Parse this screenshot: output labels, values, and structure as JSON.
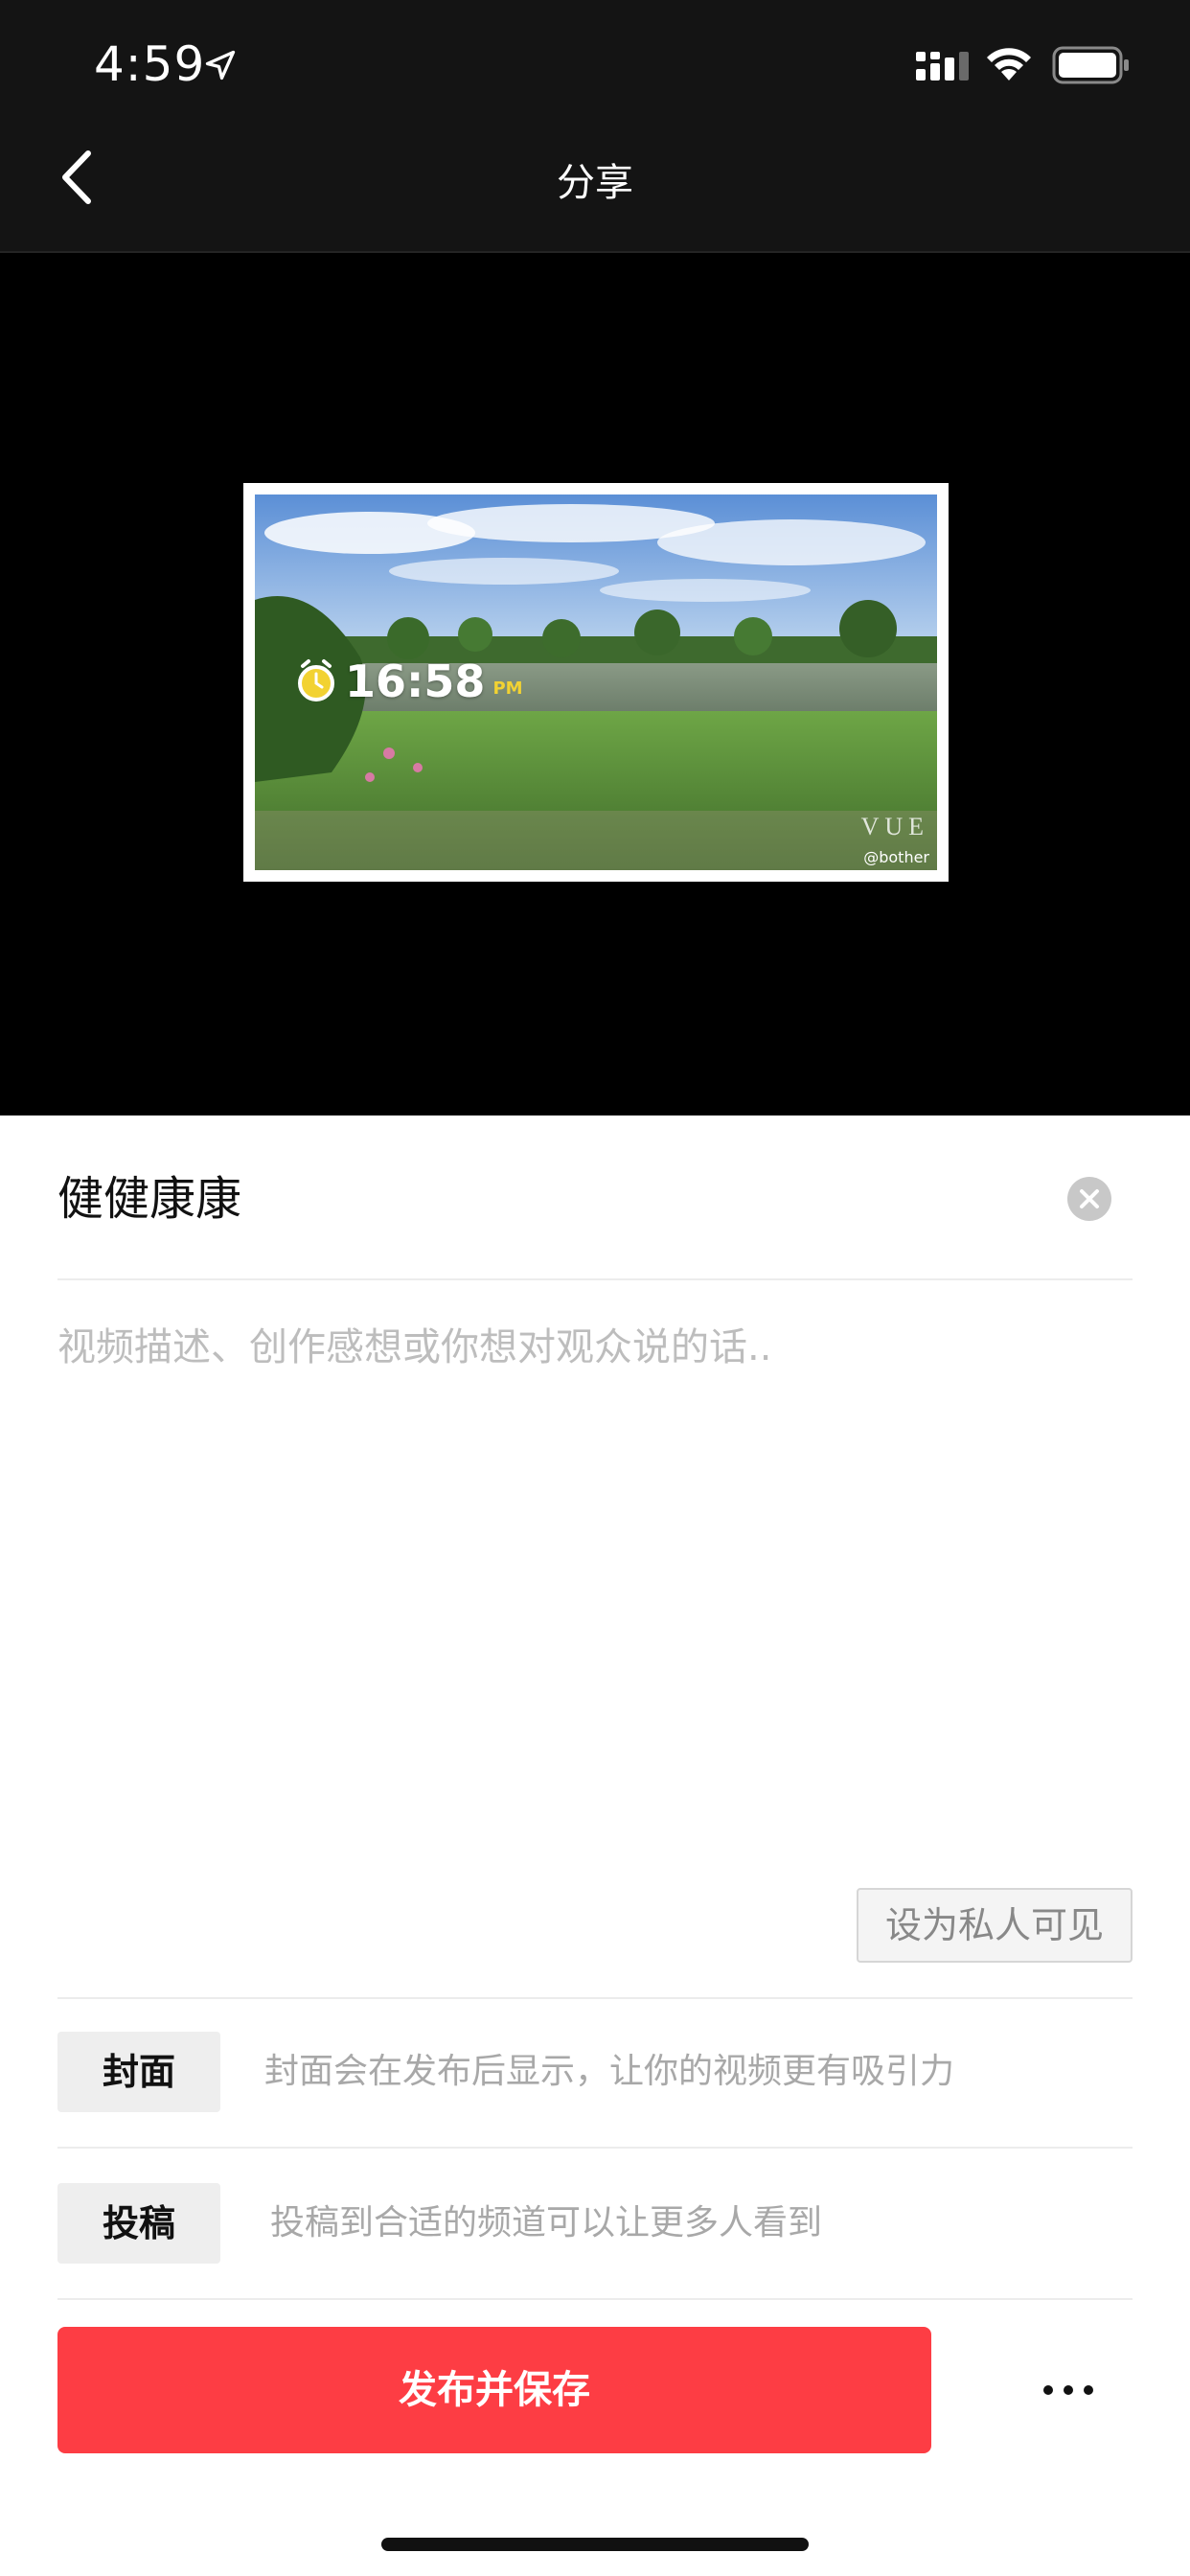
{
  "status_bar": {
    "time": "4:59"
  },
  "nav": {
    "title": "分享",
    "back_icon": "chevron-left-icon"
  },
  "preview": {
    "clock_time": "16:58",
    "clock_ampm": "PM",
    "brand": "VUE",
    "watermark": "@bother"
  },
  "form": {
    "title_value": "健健康康",
    "description_placeholder": "视频描述、创作感想或你想对观众说的话..",
    "private_button": "设为私人可见",
    "cover": {
      "label": "封面",
      "hint": "封面会在发布后显示，让你的视频更有吸引力"
    },
    "submit": {
      "label": "投稿",
      "hint": "投稿到合适的频道可以让更多人看到"
    }
  },
  "actions": {
    "publish_label": "发布并保存",
    "more_icon": "more-horizontal-icon"
  },
  "colors": {
    "accent": "#fd3d44",
    "header_bg": "#141414",
    "preview_bg": "#000000"
  }
}
